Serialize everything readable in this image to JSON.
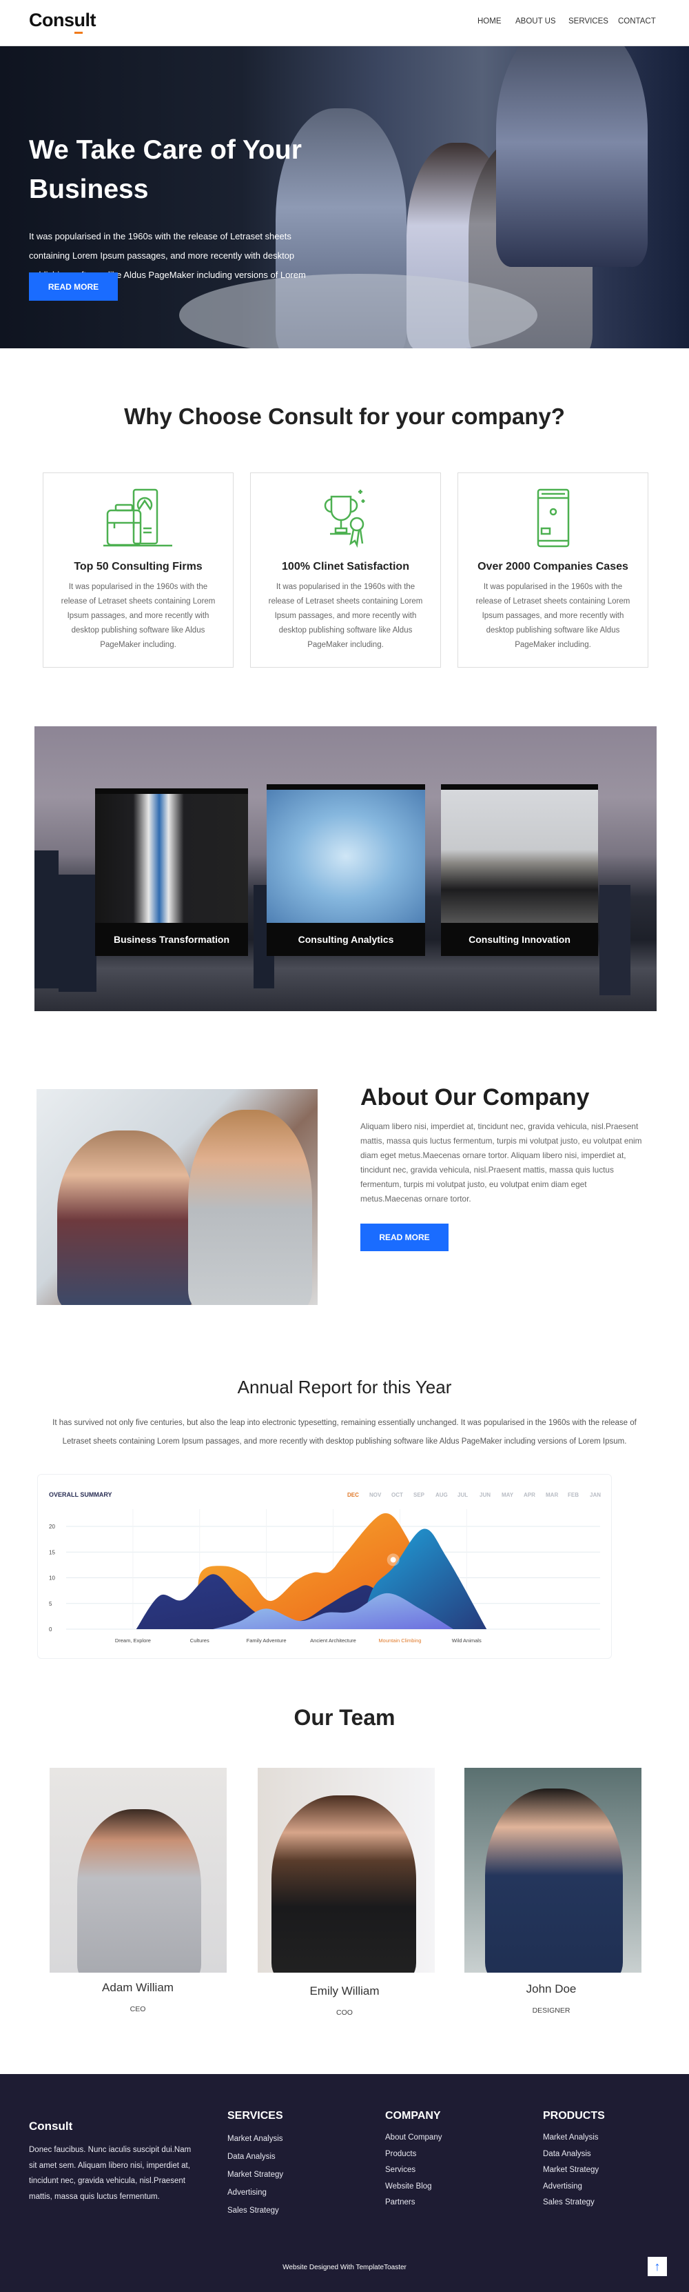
{
  "header": {
    "logo": "Consult",
    "nav": [
      "HOME",
      "ABOUT US",
      "SERVICES",
      "CONTACT"
    ]
  },
  "hero": {
    "title": "We Take Care of Your Business",
    "text": "It was popularised in the 1960s with the release of Letraset sheets containing Lorem Ipsum passages, and more recently with desktop publishing software like Aldus PageMaker including versions of Lorem Ipsum.",
    "button": "READ MORE"
  },
  "why": {
    "title": "Why Choose Consult for your company?",
    "cards": [
      {
        "icon": "briefcase-chart-icon",
        "title": "Top 50 Consulting Firms",
        "text": "It was popularised in the 1960s with the release of Letraset sheets containing Lorem Ipsum passages, and more recently with desktop publishing software like Aldus PageMaker including."
      },
      {
        "icon": "trophy-icon",
        "title": "100% Clinet Satisfaction",
        "text": "It was popularised in the 1960s with the release of Letraset sheets containing Lorem Ipsum passages, and more recently with desktop publishing software like Aldus PageMaker including."
      },
      {
        "icon": "server-cabinet-icon",
        "title": "Over 2000 Companies Cases",
        "text": "It was popularised in the 1960s with the release of Letraset sheets containing Lorem Ipsum passages, and more recently with desktop publishing software like Aldus PageMaker including."
      }
    ]
  },
  "services": [
    "Business Transformation",
    "Consulting Analytics",
    "Consulting Innovation"
  ],
  "about": {
    "title": "About Our Company",
    "text": "Aliquam libero nisi, imperdiet at, tincidunt nec, gravida vehicula, nisl.Praesent mattis, massa quis luctus fermentum, turpis mi volutpat justo, eu volutpat enim diam eget metus.Maecenas ornare tortor. Aliquam libero nisi, imperdiet at, tincidunt nec, gravida vehicula, nisl.Praesent mattis, massa quis luctus fermentum, turpis mi volutpat justo, eu volutpat enim diam eget metus.Maecenas ornare tortor.",
    "button": "READ MORE"
  },
  "report": {
    "title": "Annual Report for this Year",
    "text": "It has survived not only five centuries, but also the leap into electronic typesetting, remaining essentially unchanged. It was popularised in the 1960s with the release of Letraset sheets containing Lorem Ipsum passages, and more recently with desktop publishing software like Aldus PageMaker including versions of Lorem Ipsum."
  },
  "chart_data": {
    "type": "area",
    "title": "OVERALL SUMMARY",
    "months": [
      "DEC",
      "NOV",
      "OCT",
      "SEP",
      "AUG",
      "JUL",
      "JUN",
      "MAY",
      "APR",
      "MAR",
      "FEB",
      "JAN"
    ],
    "active_month": "DEC",
    "categories": [
      "Dream, Explore",
      "Cultures",
      "Family Adventure",
      "Ancient Architecture",
      "Mountain Climbing",
      "Wild Animals"
    ],
    "highlight_category": "Mountain Climbing",
    "yticks": [
      0,
      5,
      10,
      15,
      20
    ],
    "ylim": [
      0,
      24
    ],
    "xlim": [
      0,
      8
    ],
    "grid": true,
    "colors": {
      "orange": "#f07a1a",
      "navy": "#27306e",
      "blue": "#1a9ad6",
      "light": "#8fb6ea",
      "highlight": "#e07a2a"
    },
    "series": [
      {
        "color": "orange",
        "points": [
          [
            2.0,
            0
          ],
          [
            2.0,
            10.5
          ],
          [
            2.35,
            12.3
          ],
          [
            2.7,
            10.5
          ],
          [
            3.05,
            5.5
          ],
          [
            3.45,
            9.5
          ],
          [
            3.7,
            11
          ],
          [
            3.95,
            11.2
          ],
          [
            4.2,
            15
          ],
          [
            4.75,
            22.5
          ],
          [
            5.1,
            18
          ],
          [
            5.4,
            8
          ],
          [
            5.6,
            0
          ]
        ]
      },
      {
        "color": "navy",
        "points": [
          [
            1.05,
            0
          ],
          [
            1.4,
            6.5
          ],
          [
            1.75,
            5.7
          ],
          [
            2.2,
            10.7
          ],
          [
            2.6,
            6
          ],
          [
            2.95,
            2.5
          ],
          [
            3.5,
            1.6
          ],
          [
            3.9,
            4.5
          ],
          [
            4.3,
            7.5
          ],
          [
            4.6,
            8
          ],
          [
            5.2,
            0
          ]
        ]
      },
      {
        "color": "blue",
        "points": [
          [
            4.4,
            0
          ],
          [
            4.6,
            8
          ],
          [
            4.9,
            12
          ],
          [
            5.35,
            19.5
          ],
          [
            5.7,
            14
          ],
          [
            6.3,
            0
          ]
        ]
      },
      {
        "color": "light",
        "points": [
          [
            2.2,
            0
          ],
          [
            2.6,
            1.5
          ],
          [
            3.0,
            4
          ],
          [
            3.5,
            1.6
          ],
          [
            3.9,
            3.2
          ],
          [
            4.3,
            3.5
          ],
          [
            4.8,
            7
          ],
          [
            5.3,
            4
          ],
          [
            5.8,
            0
          ]
        ]
      }
    ],
    "marker": {
      "x": 4.9,
      "y": 13.5
    }
  },
  "team": {
    "title": "Our Team",
    "members": [
      {
        "name": "Adam William",
        "role": "CEO"
      },
      {
        "name": "Emily William",
        "role": "COO"
      },
      {
        "name": "John Doe",
        "role": "DESIGNER"
      }
    ]
  },
  "footer": {
    "logo": "Consult",
    "text": "Donec faucibus. Nunc iaculis suscipit dui.Nam sit amet sem. Aliquam libero nisi, imperdiet at, tincidunt nec, gravida vehicula, nisl.Praesent mattis, massa quis luctus fermentum.",
    "columns": [
      {
        "title": "SERVICES",
        "items": [
          "Market Analysis",
          "Data Analysis",
          "Market Strategy",
          "Advertising",
          "Sales Strategy"
        ]
      },
      {
        "title": "COMPANY",
        "items": [
          "About Company",
          "Products",
          "Services",
          "Website Blog",
          "Partners"
        ]
      },
      {
        "title": "PRODUCTS",
        "items": [
          "Market Analysis",
          "Data Analysis",
          "Market Strategy",
          "Advertising",
          "Sales Strategy"
        ]
      }
    ],
    "credit": "Website Designed With TemplateToaster",
    "back_to_top_icon": "arrow-up-icon"
  },
  "colors": {
    "accent": "#1a6cff",
    "icon_green": "#4cb050",
    "footer_bg": "#1e1c33",
    "logo_underline": "#f07a1a"
  }
}
